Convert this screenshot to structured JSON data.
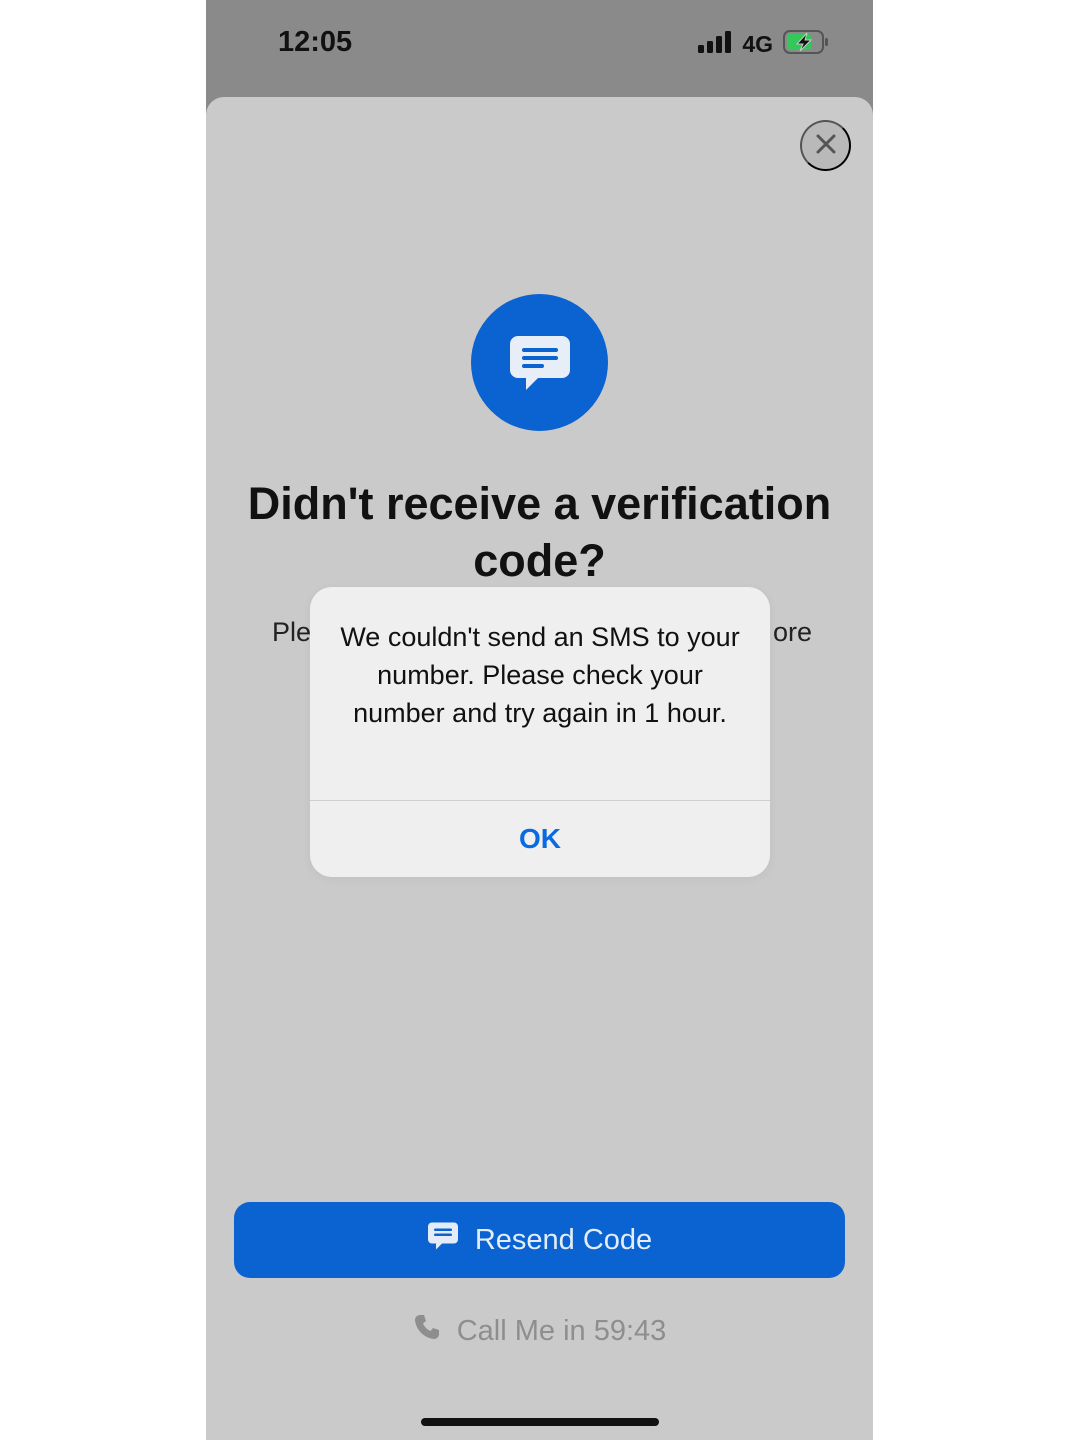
{
  "status_bar": {
    "time": "12:05",
    "network": "4G",
    "icons": [
      "signal-bars-icon",
      "battery-charging-icon"
    ]
  },
  "sheet": {
    "close_icon": "close-icon",
    "hero_icon": "message-bubble-icon",
    "title": "Didn't receive a verification code?",
    "subtitle_visible_start": "Ple",
    "subtitle_visible_end": "ore",
    "resend_label": "Resend Code",
    "resend_icon": "message-bubble-icon",
    "call_me_label": "Call Me in 59:43",
    "call_icon": "phone-icon"
  },
  "alert": {
    "message": "We couldn't send an SMS to your number. Please check your number and try again in 1 hour.",
    "ok_label": "OK"
  },
  "colors": {
    "accent": "#0a63d1",
    "link": "#0a6be0",
    "battery_green": "#34c759",
    "sheet_background": "#cacaca",
    "alert_background": "#efefef"
  }
}
